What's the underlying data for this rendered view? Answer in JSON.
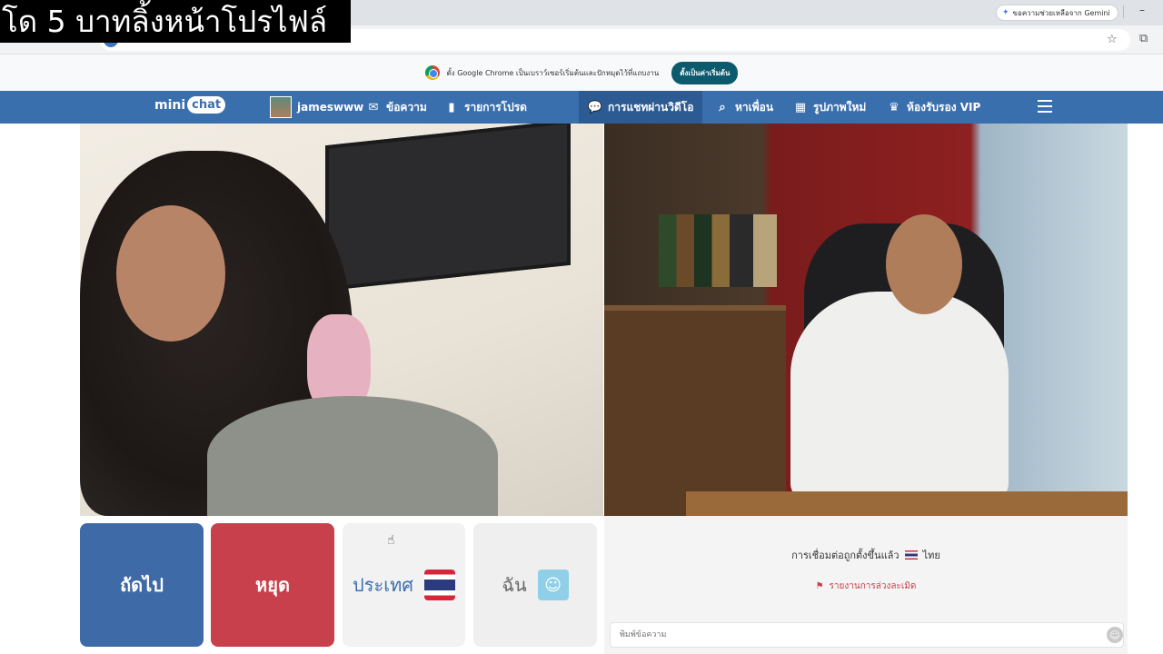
{
  "overlay_caption": "โด 5 บาทลิ้งหน้าโปรไฟล์",
  "browser": {
    "gemini_label": "ขอความช่วยเหลือจาก Gemini",
    "infobar_text": "ตั้ง Google Chrome เป็นเบราว์เซอร์เริ่มต้นและปักหมุดไว้ที่แถบงาน",
    "infobar_button": "ตั้งเป็นค่าเริ่มต้น"
  },
  "nav": {
    "logo_mini": "mini",
    "logo_chat": "chat",
    "username": "jameswww",
    "messages": "ข้อความ",
    "favorites": "รายการโปรด",
    "video_chat": "การแชทผ่านวิดีโอ",
    "find_friends": "หาเพื่อน",
    "new_photos": "รูปภาพใหม่",
    "vip": "ห้องรับรอง VIP"
  },
  "controls": {
    "next": "ถัดไป",
    "stop": "หยุด",
    "country": "ประเทศ",
    "me": "ฉัน"
  },
  "chat": {
    "status_text": "การเชื่อมต่อถูกตั้งขึ้นแล้ว",
    "country_name": "ไทย",
    "report_text": "รายงานการล่วงละเมิด",
    "input_placeholder": "พิมพ์ข้อความ"
  },
  "colors": {
    "nav_bg": "#3a6fae",
    "next_btn": "#3e6aa8",
    "stop_btn": "#c8404b"
  }
}
